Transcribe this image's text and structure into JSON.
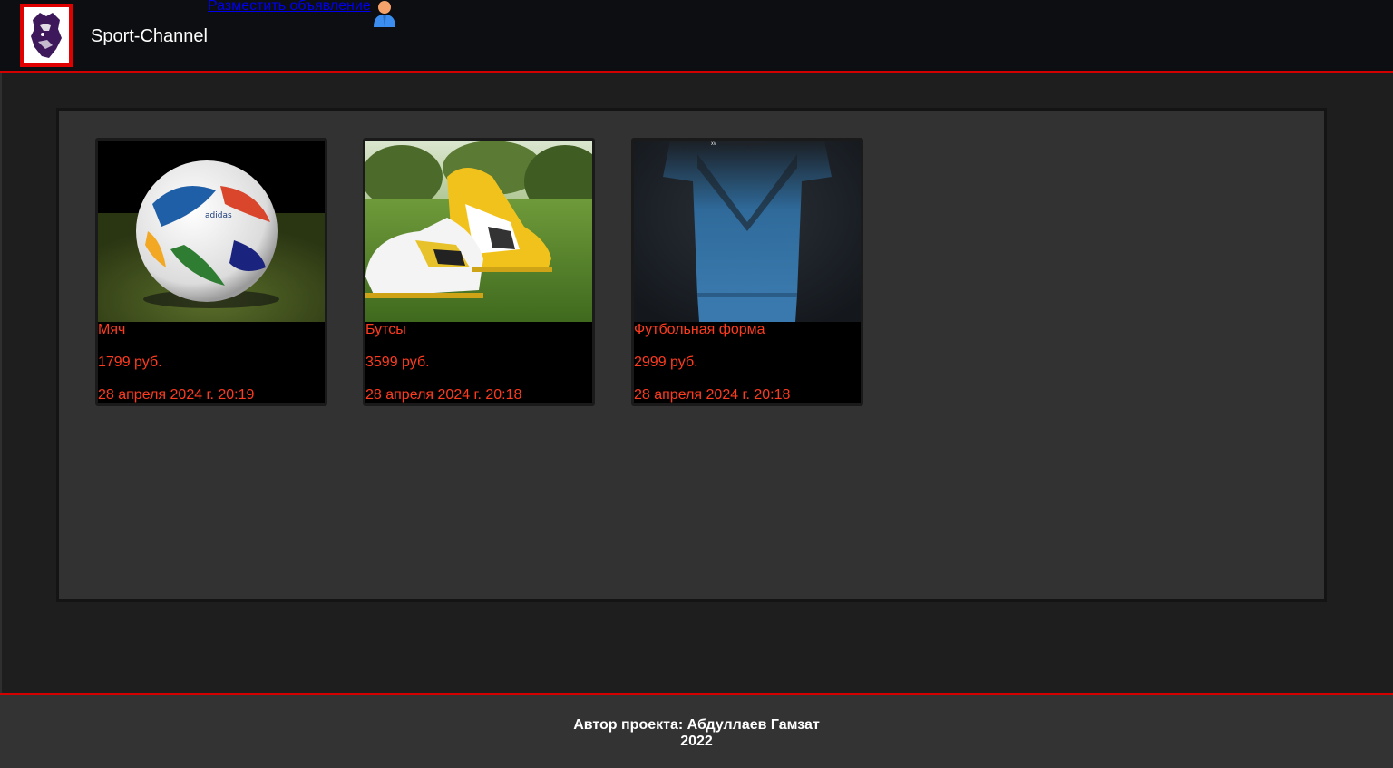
{
  "header": {
    "site_title": "Sport-Channel",
    "post_ad_label": "Разместить объявление",
    "logo_icon": "premier-league-lion-icon",
    "user_icon": "user-icon",
    "accent_color": "#d40000"
  },
  "listings": [
    {
      "title": "Мяч",
      "price": "1799 руб.",
      "date": "28 апреля 2024 г. 20:19",
      "image_icon": "soccer-ball-photo"
    },
    {
      "title": "Бутсы",
      "price": "3599 руб.",
      "date": "28 апреля 2024 г. 20:18",
      "image_icon": "football-boots-photo"
    },
    {
      "title": "Футбольная форма",
      "price": "2999 руб.",
      "date": "28 апреля 2024 г. 20:18",
      "image_icon": "football-kit-photo"
    }
  ],
  "footer": {
    "author": "Автор проекта: Абдуллаев Гамзат",
    "year": "2022"
  }
}
